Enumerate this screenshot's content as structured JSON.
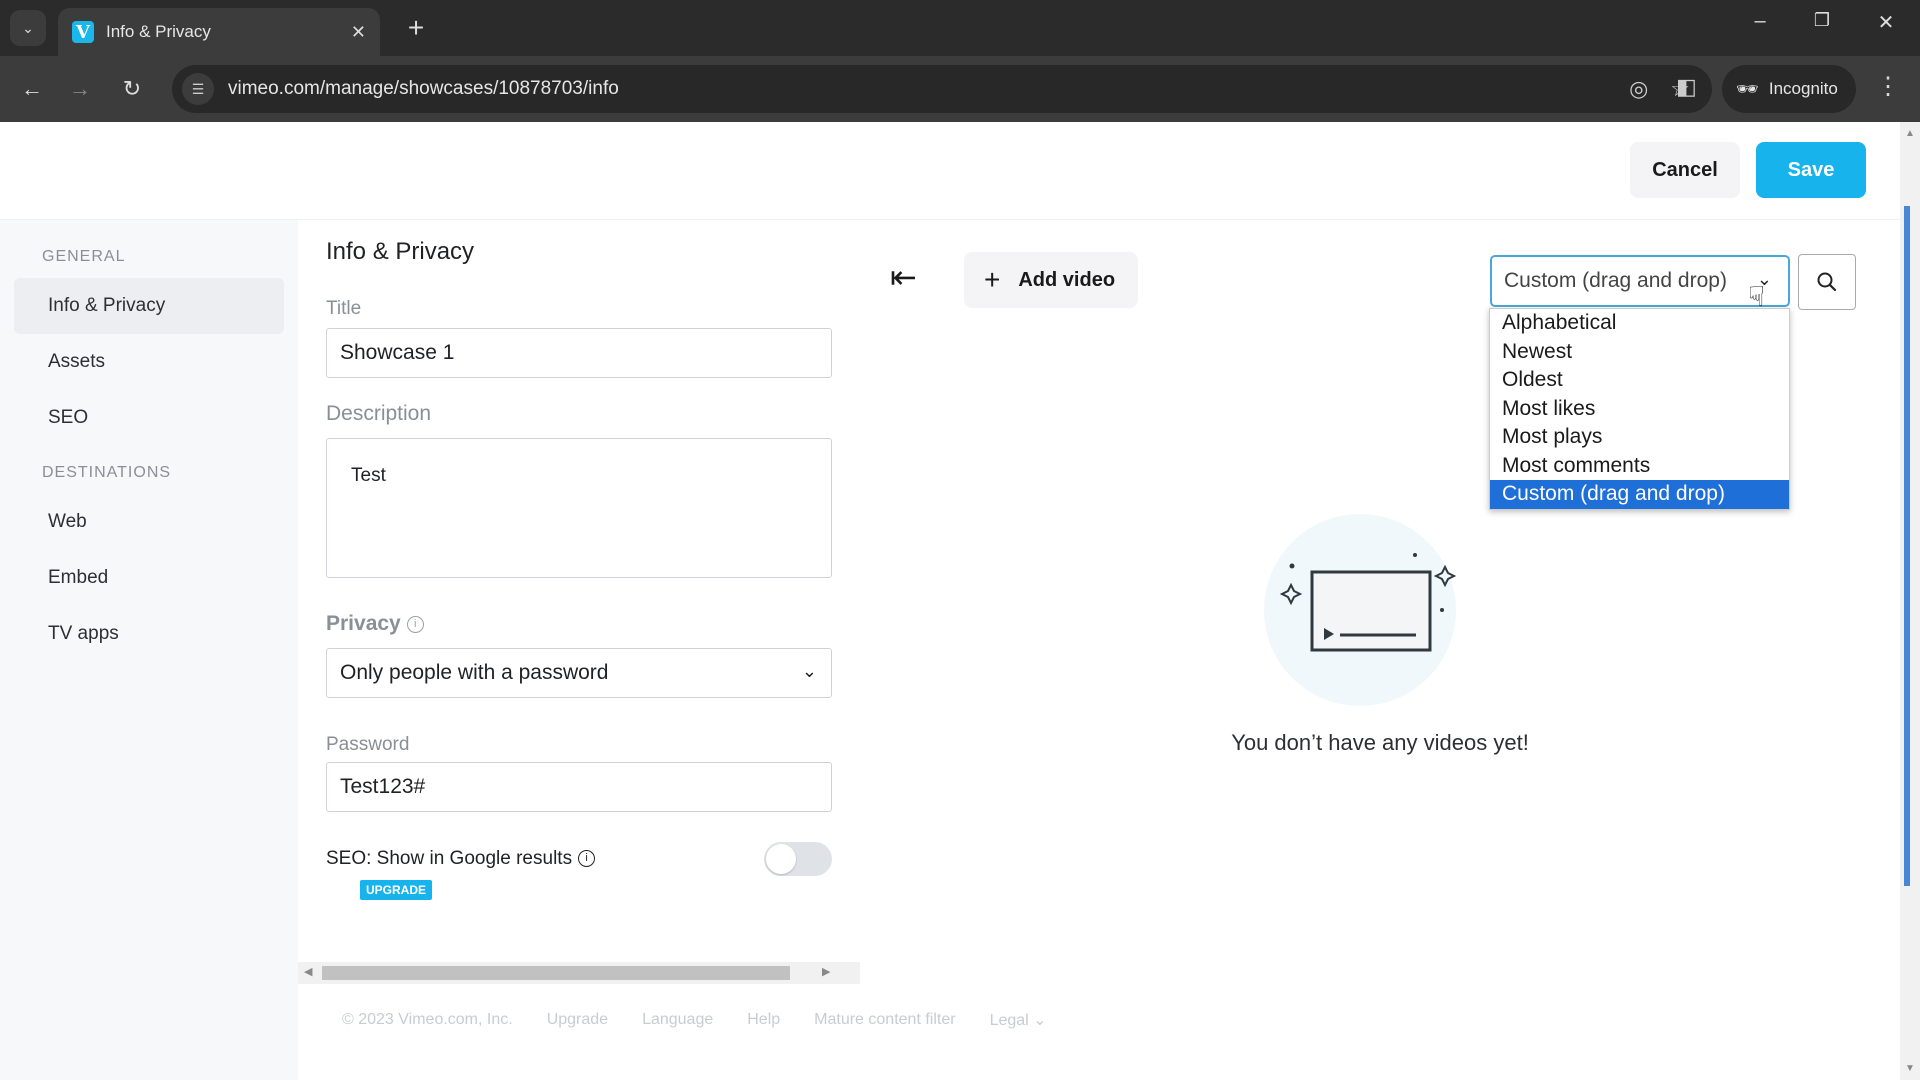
{
  "browser": {
    "tab_title": "Info & Privacy",
    "favicon_letter": "V",
    "url": "vimeo.com/manage/showcases/10878703/info",
    "incognito_label": "Incognito"
  },
  "header": {
    "cancel_label": "Cancel",
    "save_label": "Save"
  },
  "sidebar": {
    "sections": [
      {
        "heading": "GENERAL",
        "items": [
          "Info & Privacy",
          "Assets",
          "SEO"
        ]
      },
      {
        "heading": "DESTINATIONS",
        "items": [
          "Web",
          "Embed",
          "TV apps"
        ]
      }
    ],
    "active_item": "Info & Privacy"
  },
  "form": {
    "title": "Info & Privacy",
    "title_label": "Title",
    "title_value": "Showcase 1",
    "description_label": "Description",
    "description_value": "Test",
    "privacy_label": "Privacy",
    "privacy_value": "Only people with a password",
    "password_label": "Password",
    "password_value": "Test123#",
    "seo_label": "SEO: Show in Google results",
    "seo_enabled": false,
    "upgrade_badge": "UPGRADE"
  },
  "content": {
    "add_video_label": "Add video",
    "sort_selected": "Custom (drag and drop)",
    "sort_options": [
      "Alphabetical",
      "Newest",
      "Oldest",
      "Most likes",
      "Most plays",
      "Most comments",
      "Custom (drag and drop)"
    ],
    "empty_message": "You don’t have any videos yet!"
  },
  "footer": {
    "links": [
      "© 2023 Vimeo.com, Inc.",
      "Upgrade",
      "Language",
      "Help",
      "Mature content filter",
      "Legal ⌄"
    ]
  },
  "colors": {
    "brand_blue": "#17b3ec",
    "selected_option": "#1f6fd9"
  }
}
